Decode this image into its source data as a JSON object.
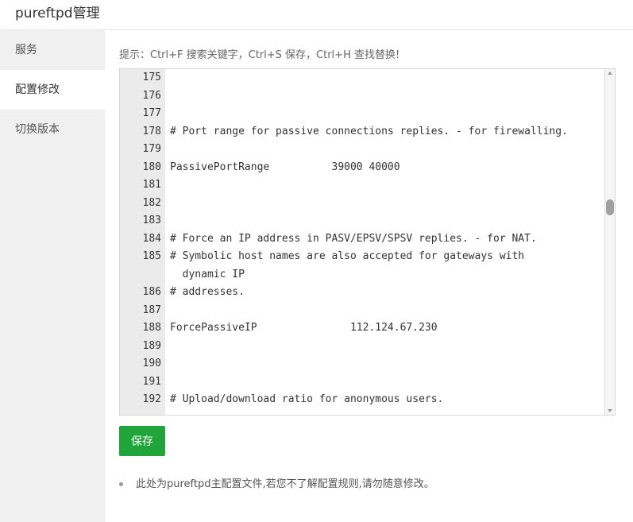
{
  "window": {
    "title": "pureftpd管理"
  },
  "sidebar": {
    "items": [
      {
        "label": "服务",
        "active": false
      },
      {
        "label": "配置修改",
        "active": true
      },
      {
        "label": "切换版本",
        "active": false
      }
    ]
  },
  "main": {
    "hint": "提示：Ctrl+F 搜索关键字，Ctrl+S 保存，Ctrl+H 查找替换!",
    "editor": {
      "lines": [
        {
          "num": "175",
          "code": ""
        },
        {
          "num": "176",
          "code": ""
        },
        {
          "num": "177",
          "code": ""
        },
        {
          "num": "178",
          "code": "# Port range for passive connections replies. - for firewalling."
        },
        {
          "num": "179",
          "code": ""
        },
        {
          "num": "180",
          "code": "PassivePortRange          39000 40000"
        },
        {
          "num": "181",
          "code": ""
        },
        {
          "num": "182",
          "code": ""
        },
        {
          "num": "183",
          "code": ""
        },
        {
          "num": "184",
          "code": "# Force an IP address in PASV/EPSV/SPSV replies. - for NAT."
        },
        {
          "num": "185",
          "code": "# Symbolic host names are also accepted for gateways with\n  dynamic IP"
        },
        {
          "num": "186",
          "code": "# addresses."
        },
        {
          "num": "187",
          "code": ""
        },
        {
          "num": "188",
          "code": "ForcePassiveIP               112.124.67.230"
        },
        {
          "num": "189",
          "code": ""
        },
        {
          "num": "190",
          "code": ""
        },
        {
          "num": "191",
          "code": ""
        },
        {
          "num": "192",
          "code": "# Upload/download ratio for anonymous users."
        }
      ]
    },
    "save_label": "保存",
    "note": "此处为pureftpd主配置文件,若您不了解配置规则,请勿随意修改。"
  },
  "colors": {
    "accent": "#20a53a",
    "sidebar_bg": "#f0f0f0",
    "gutter_bg": "#ebebeb"
  }
}
